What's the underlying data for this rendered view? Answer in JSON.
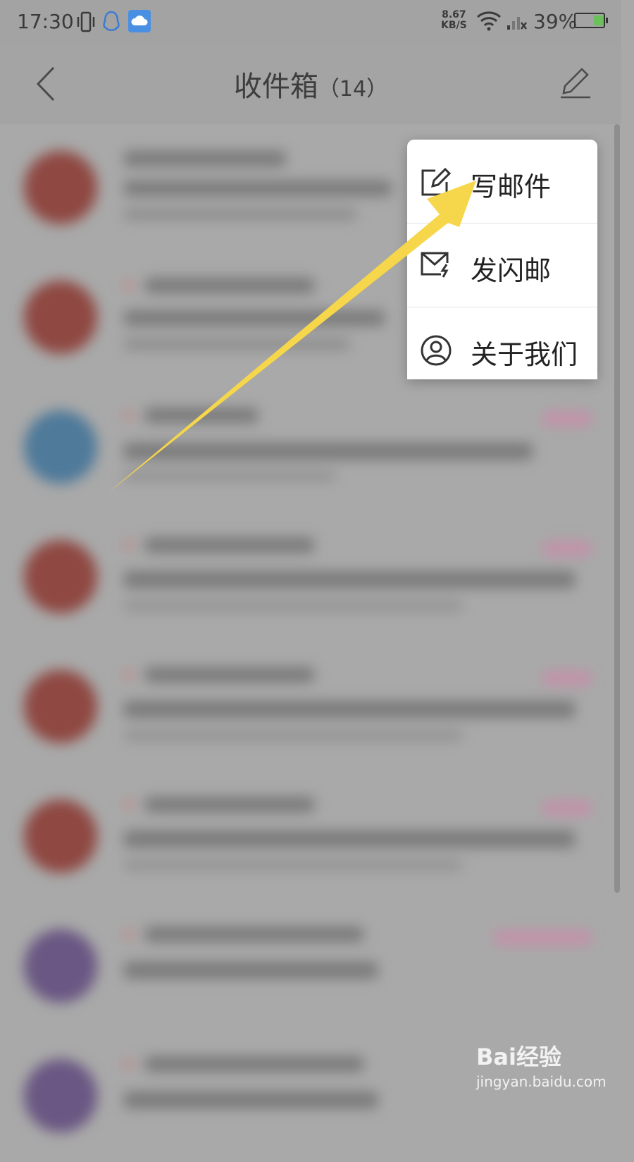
{
  "status_bar": {
    "time": "17:30",
    "net_speed_value": "8.67",
    "net_speed_unit": "KB/S",
    "battery_percent": "39%"
  },
  "header": {
    "title": "收件箱",
    "count": "（14）"
  },
  "menu": {
    "items": [
      {
        "label": "写邮件",
        "icon": "compose-icon"
      },
      {
        "label": "发闪邮",
        "icon": "flash-mail-icon"
      },
      {
        "label": "关于我们",
        "icon": "profile-icon"
      }
    ]
  },
  "watermark": {
    "logo_text": "Bai经验",
    "url": "jingyan.baidu.com"
  },
  "colors": {
    "accent_arrow": "#f6d64a",
    "avatar_red": "#8f4842",
    "avatar_purple": "#6a5783",
    "avatar_blue": "#4f7a9a"
  }
}
